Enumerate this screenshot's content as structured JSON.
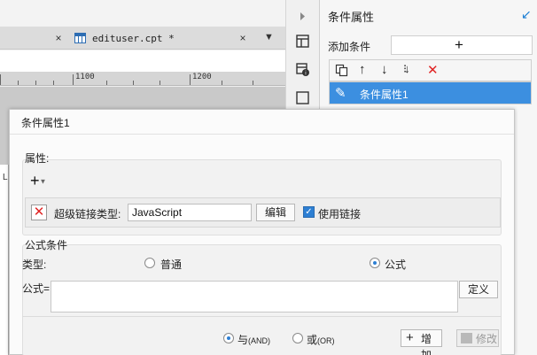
{
  "tabs": {
    "active_label": "edituser.cpt *",
    "close_symbol": "×",
    "menu_symbol": "▼"
  },
  "ruler": {
    "label_1100": "1100",
    "label_1200": "1200"
  },
  "canvas": {
    "cell_text": "L"
  },
  "panel": {
    "title": "条件属性",
    "add_condition_label": "添加条件",
    "add_symbol": "+",
    "selected_condition": "条件属性1"
  },
  "dialog": {
    "title": "条件属性1",
    "properties_title": "属性:",
    "add_property_symbol": "+",
    "hyperlink_type_label": "超级链接类型:",
    "hyperlink_type_value": "JavaScript",
    "edit_button": "编辑",
    "use_link_label": "使用链接",
    "use_link_checked": true,
    "formula_condition_title": "公式条件",
    "type_label": "类型:",
    "type_options": [
      "普通",
      "公式"
    ],
    "type_selected": "公式",
    "formula_label": "公式=",
    "define_button": "定义",
    "logic_and_main": "与",
    "logic_and_sub": "(AND)",
    "logic_or_main": "或",
    "logic_or_sub": "(OR)",
    "logic_selected": "与",
    "add_button": "增加",
    "modify_button": "修改"
  },
  "colors": {
    "selection_blue": "#3c8fe0",
    "delete_red": "#e02424",
    "accent_blue": "#2d7fd3"
  }
}
